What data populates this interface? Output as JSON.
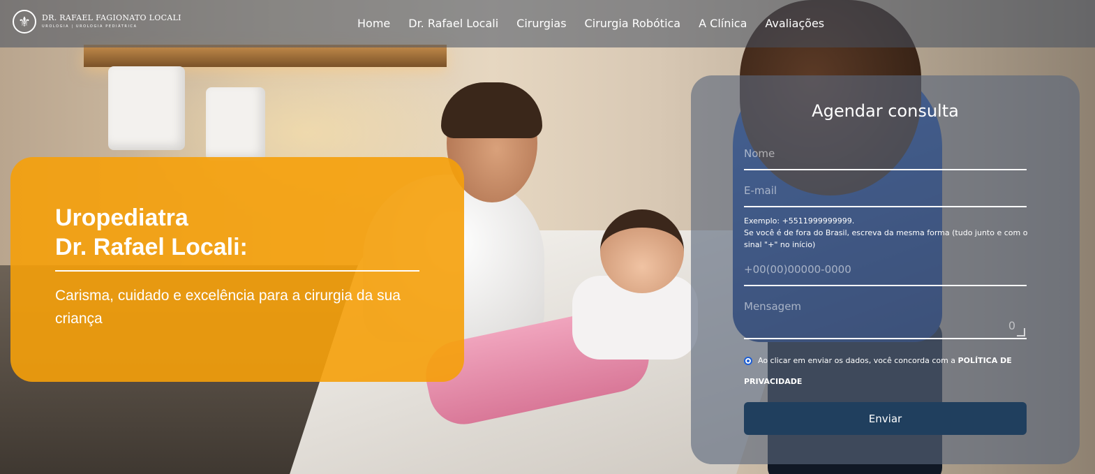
{
  "header": {
    "logo": {
      "icon": "fleur-de-lis-icon",
      "name": "DR. RAFAEL FAGIONATO LOCALI",
      "tagline": "UROLOGIA | UROLOGIA PEDIÁTRICA"
    },
    "nav": [
      "Home",
      "Dr. Rafael Locali",
      "Cirurgias",
      "Cirurgia Robótica",
      "A Clínica",
      "Avaliações"
    ]
  },
  "hero": {
    "title_line1": "Uropediatra",
    "title_line2": "Dr. Rafael Locali:",
    "subtitle": "Carisma, cuidado e excelência para a cirurgia da sua criança",
    "color": "#f5a00a"
  },
  "form": {
    "title": "Agendar consulta",
    "name_placeholder": "Nome",
    "email_placeholder": "E-mail",
    "phone_hint_line1": "Exemplo: +5511999999999.",
    "phone_hint_line2": "Se você é de fora do Brasil, escreva da mesma forma (tudo junto e com o sinal \"+\" no início)",
    "phone_placeholder": "+00(00)00000-0000",
    "message_placeholder": "Mensagem",
    "message_counter": "0",
    "consent_text": "Ao clicar em enviar os dados, você concorda com a ",
    "consent_link": "POLÍTICA DE PRIVACIDADE",
    "submit_label": "Enviar",
    "submit_color": "#203f5e"
  }
}
